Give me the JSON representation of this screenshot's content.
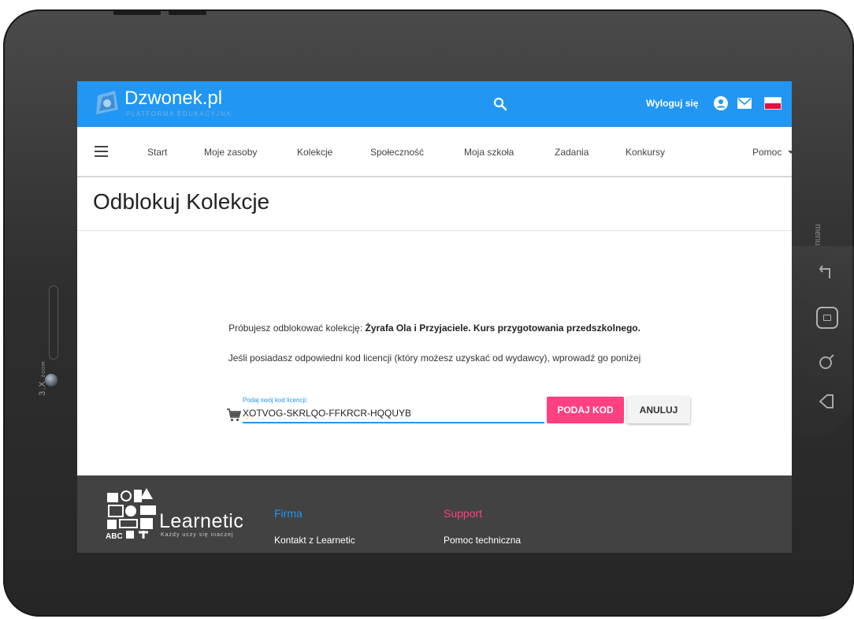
{
  "header": {
    "logo_text": "Dzwonek.pl",
    "logo_sub": "PLATFORMA EDUKACYJNA",
    "logout": "Wyloguj się",
    "colors": {
      "bar": "#2196f3",
      "accent": "#ff4081"
    }
  },
  "nav": {
    "items": [
      "Start",
      "Moje zasoby",
      "Kolekcje",
      "Społeczność",
      "Moja szkoła",
      "Zadania",
      "Konkursy",
      "Pomoc"
    ]
  },
  "page": {
    "title": "Odblokuj Kolekcje",
    "message_prefix": "Próbujesz odblokować kolekcję:",
    "collection_name": "Żyrafa Ola i Przyjaciele. Kurs przygotowania przedszkolnego.",
    "instruction": "Jeśli posiadasz odpowiedni kod licencji (który możesz uzyskać od wydawcy), wprowadź go poniżej",
    "field_label": "Podaj swój kod licencji:",
    "code_value": "XOTVOG-SKRLQO-FFKRCR-HQQUYB",
    "submit_label": "PODAJ KOD",
    "cancel_label": "ANULUJ"
  },
  "footer": {
    "brand": "Learnetic",
    "brand_sub": "Każdy uczy się inaczej",
    "col1_title": "Firma",
    "col1_link": "Kontakt z Learnetic",
    "col2_title": "Support",
    "col2_link": "Pomoc techniczna"
  },
  "device": {
    "side_label": "3.X",
    "side_sub": "zoom",
    "menu_label": "menu"
  },
  "icons": [
    "search-icon",
    "user-icon",
    "mail-icon",
    "flag-icon",
    "hamburger-icon",
    "cart-icon",
    "back-icon",
    "home-icon",
    "search-hw-icon",
    "return-icon"
  ]
}
